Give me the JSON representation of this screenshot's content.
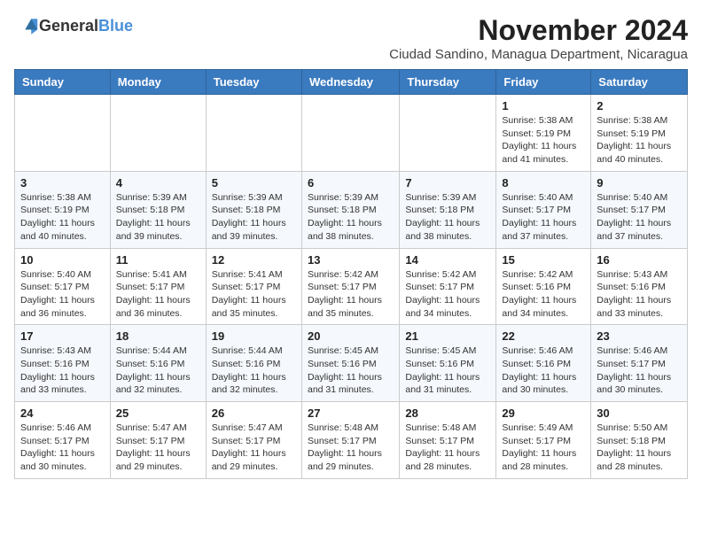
{
  "header": {
    "logo_general": "General",
    "logo_blue": "Blue",
    "month_title": "November 2024",
    "location": "Ciudad Sandino, Managua Department, Nicaragua"
  },
  "days_of_week": [
    "Sunday",
    "Monday",
    "Tuesday",
    "Wednesday",
    "Thursday",
    "Friday",
    "Saturday"
  ],
  "weeks": [
    {
      "days": [
        {
          "num": "",
          "info": ""
        },
        {
          "num": "",
          "info": ""
        },
        {
          "num": "",
          "info": ""
        },
        {
          "num": "",
          "info": ""
        },
        {
          "num": "",
          "info": ""
        },
        {
          "num": "1",
          "info": "Sunrise: 5:38 AM\nSunset: 5:19 PM\nDaylight: 11 hours and 41 minutes."
        },
        {
          "num": "2",
          "info": "Sunrise: 5:38 AM\nSunset: 5:19 PM\nDaylight: 11 hours and 40 minutes."
        }
      ]
    },
    {
      "days": [
        {
          "num": "3",
          "info": "Sunrise: 5:38 AM\nSunset: 5:19 PM\nDaylight: 11 hours and 40 minutes."
        },
        {
          "num": "4",
          "info": "Sunrise: 5:39 AM\nSunset: 5:18 PM\nDaylight: 11 hours and 39 minutes."
        },
        {
          "num": "5",
          "info": "Sunrise: 5:39 AM\nSunset: 5:18 PM\nDaylight: 11 hours and 39 minutes."
        },
        {
          "num": "6",
          "info": "Sunrise: 5:39 AM\nSunset: 5:18 PM\nDaylight: 11 hours and 38 minutes."
        },
        {
          "num": "7",
          "info": "Sunrise: 5:39 AM\nSunset: 5:18 PM\nDaylight: 11 hours and 38 minutes."
        },
        {
          "num": "8",
          "info": "Sunrise: 5:40 AM\nSunset: 5:17 PM\nDaylight: 11 hours and 37 minutes."
        },
        {
          "num": "9",
          "info": "Sunrise: 5:40 AM\nSunset: 5:17 PM\nDaylight: 11 hours and 37 minutes."
        }
      ]
    },
    {
      "days": [
        {
          "num": "10",
          "info": "Sunrise: 5:40 AM\nSunset: 5:17 PM\nDaylight: 11 hours and 36 minutes."
        },
        {
          "num": "11",
          "info": "Sunrise: 5:41 AM\nSunset: 5:17 PM\nDaylight: 11 hours and 36 minutes."
        },
        {
          "num": "12",
          "info": "Sunrise: 5:41 AM\nSunset: 5:17 PM\nDaylight: 11 hours and 35 minutes."
        },
        {
          "num": "13",
          "info": "Sunrise: 5:42 AM\nSunset: 5:17 PM\nDaylight: 11 hours and 35 minutes."
        },
        {
          "num": "14",
          "info": "Sunrise: 5:42 AM\nSunset: 5:17 PM\nDaylight: 11 hours and 34 minutes."
        },
        {
          "num": "15",
          "info": "Sunrise: 5:42 AM\nSunset: 5:16 PM\nDaylight: 11 hours and 34 minutes."
        },
        {
          "num": "16",
          "info": "Sunrise: 5:43 AM\nSunset: 5:16 PM\nDaylight: 11 hours and 33 minutes."
        }
      ]
    },
    {
      "days": [
        {
          "num": "17",
          "info": "Sunrise: 5:43 AM\nSunset: 5:16 PM\nDaylight: 11 hours and 33 minutes."
        },
        {
          "num": "18",
          "info": "Sunrise: 5:44 AM\nSunset: 5:16 PM\nDaylight: 11 hours and 32 minutes."
        },
        {
          "num": "19",
          "info": "Sunrise: 5:44 AM\nSunset: 5:16 PM\nDaylight: 11 hours and 32 minutes."
        },
        {
          "num": "20",
          "info": "Sunrise: 5:45 AM\nSunset: 5:16 PM\nDaylight: 11 hours and 31 minutes."
        },
        {
          "num": "21",
          "info": "Sunrise: 5:45 AM\nSunset: 5:16 PM\nDaylight: 11 hours and 31 minutes."
        },
        {
          "num": "22",
          "info": "Sunrise: 5:46 AM\nSunset: 5:16 PM\nDaylight: 11 hours and 30 minutes."
        },
        {
          "num": "23",
          "info": "Sunrise: 5:46 AM\nSunset: 5:17 PM\nDaylight: 11 hours and 30 minutes."
        }
      ]
    },
    {
      "days": [
        {
          "num": "24",
          "info": "Sunrise: 5:46 AM\nSunset: 5:17 PM\nDaylight: 11 hours and 30 minutes."
        },
        {
          "num": "25",
          "info": "Sunrise: 5:47 AM\nSunset: 5:17 PM\nDaylight: 11 hours and 29 minutes."
        },
        {
          "num": "26",
          "info": "Sunrise: 5:47 AM\nSunset: 5:17 PM\nDaylight: 11 hours and 29 minutes."
        },
        {
          "num": "27",
          "info": "Sunrise: 5:48 AM\nSunset: 5:17 PM\nDaylight: 11 hours and 29 minutes."
        },
        {
          "num": "28",
          "info": "Sunrise: 5:48 AM\nSunset: 5:17 PM\nDaylight: 11 hours and 28 minutes."
        },
        {
          "num": "29",
          "info": "Sunrise: 5:49 AM\nSunset: 5:17 PM\nDaylight: 11 hours and 28 minutes."
        },
        {
          "num": "30",
          "info": "Sunrise: 5:50 AM\nSunset: 5:18 PM\nDaylight: 11 hours and 28 minutes."
        }
      ]
    }
  ]
}
